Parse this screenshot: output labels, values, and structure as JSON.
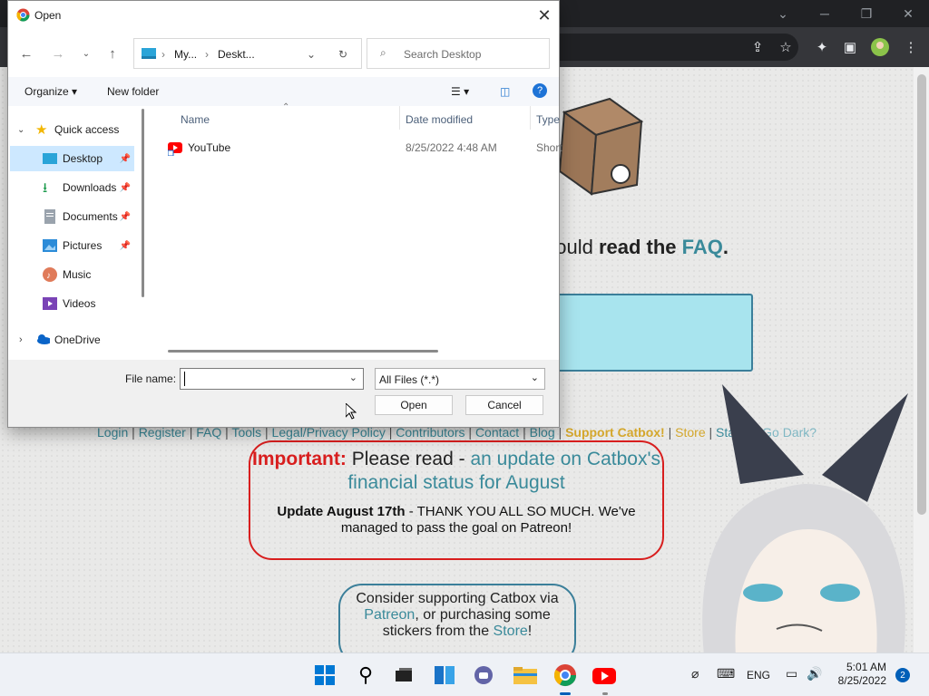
{
  "dialog": {
    "title": "Open",
    "address": {
      "crumb1": "My...",
      "crumb2": "Deskt..."
    },
    "search_placeholder": "Search Desktop",
    "commands": {
      "organize": "Organize",
      "new_folder": "New folder"
    },
    "nav_items": [
      {
        "label": "Quick access",
        "icon": "star-icon"
      },
      {
        "label": "Desktop",
        "icon": "desktop-icon",
        "pinned": true,
        "selected": true
      },
      {
        "label": "Downloads",
        "icon": "download-icon",
        "pinned": true
      },
      {
        "label": "Documents",
        "icon": "document-icon",
        "pinned": true
      },
      {
        "label": "Pictures",
        "icon": "picture-icon",
        "pinned": true
      },
      {
        "label": "Music",
        "icon": "music-icon"
      },
      {
        "label": "Videos",
        "icon": "video-icon"
      },
      {
        "label": "OneDrive",
        "icon": "cloud-icon"
      }
    ],
    "columns": {
      "name": "Name",
      "date": "Date modified",
      "type": "Type"
    },
    "files": [
      {
        "name": "YouTube",
        "date": "8/25/2022 4:48 AM",
        "type": "Short"
      }
    ],
    "filename_label": "File name:",
    "filename_value": "",
    "filter_value": "All Files (*.*)",
    "open_label": "Open",
    "cancel_label": "Cancel"
  },
  "page": {
    "faq_line": {
      "prefix": "hould ",
      "bold": "read the ",
      "link": "FAQ",
      "suffix": "."
    },
    "navlinks": {
      "login": "Login",
      "register": "Register",
      "faq": "FAQ",
      "tools": "Tools",
      "legal": "Legal/Privacy Policy",
      "contributors": "Contributors",
      "contact": "Contact",
      "blog": "Blog",
      "support": "Support Catbox!",
      "store": "Store",
      "status": "Status",
      "dark": "Go Dark?",
      "sep": " | "
    },
    "important": {
      "label": "Important:",
      "text": " Please read - ",
      "link": "an update on Catbox's financial status for August",
      "update_bold": "Update August 17th",
      "update_text": " - THANK YOU ALL SO MUCH. We've managed to pass the goal on Patreon!"
    },
    "support": {
      "line1": "Consider supporting Catbox via ",
      "patreon": "Patreon",
      "line2": ", or purchasing some stickers from the ",
      "store": "Store",
      "end": "!"
    }
  },
  "taskbar": {
    "lang": "ENG",
    "time": "5:01 AM",
    "date": "8/25/2022",
    "notifications": "2"
  }
}
